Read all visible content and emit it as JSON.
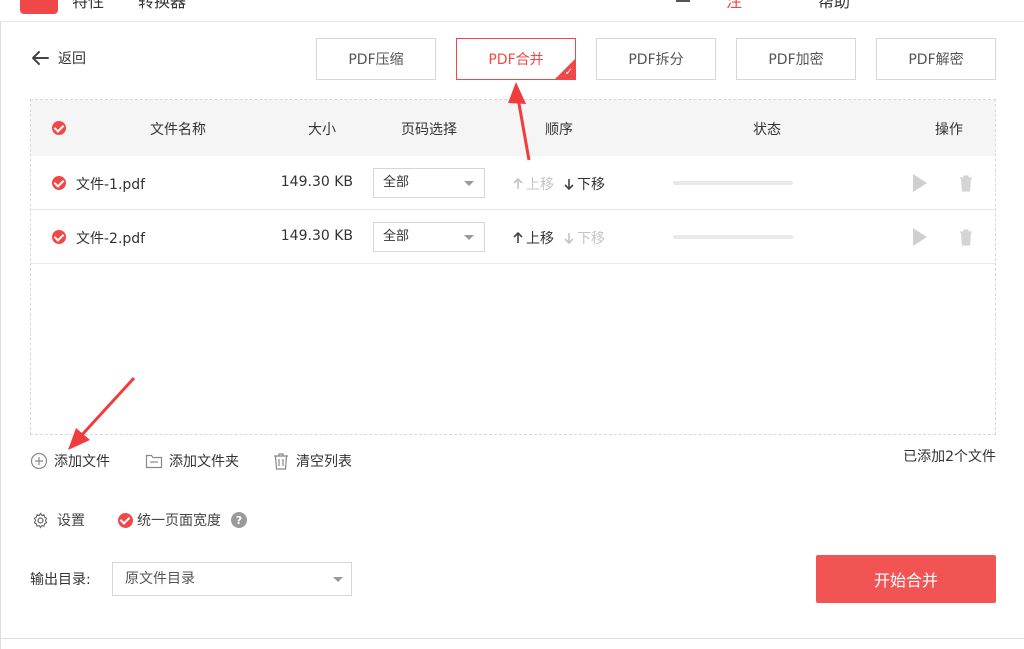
{
  "topbar": {
    "app_name_fragment": "特性",
    "app_subtitle_fragment": "转换器",
    "menu_item_2": "注",
    "menu_item_3": "帮助",
    "menu_item_4": "—"
  },
  "nav": {
    "back_label": "返回"
  },
  "tabs": [
    {
      "label": "PDF压缩",
      "active": false
    },
    {
      "label": "PDF合并",
      "active": true
    },
    {
      "label": "PDF拆分",
      "active": false
    },
    {
      "label": "PDF加密",
      "active": false
    },
    {
      "label": "PDF解密",
      "active": false
    }
  ],
  "table": {
    "headers": {
      "name": "文件名称",
      "size": "大小",
      "pages": "页码选择",
      "order": "顺序",
      "status": "状态",
      "ops": "操作"
    },
    "rows": [
      {
        "name": "文件-1.pdf",
        "size": "149.30 KB",
        "pages": "全部",
        "up": "上移",
        "down": "下移",
        "up_enabled": false,
        "down_enabled": true
      },
      {
        "name": "文件-2.pdf",
        "size": "149.30 KB",
        "pages": "全部",
        "up": "上移",
        "down": "下移",
        "up_enabled": true,
        "down_enabled": false
      }
    ]
  },
  "actions": {
    "add_file": "添加文件",
    "add_folder": "添加文件夹",
    "clear_list": "清空列表",
    "added_count": "已添加2个文件"
  },
  "settings": {
    "label": "设置",
    "unify_width": "统一页面宽度",
    "help": "?"
  },
  "output": {
    "label": "输出目录:",
    "value": "原文件目录"
  },
  "start_button": "开始合并",
  "colors": {
    "accent": "#f04848",
    "button": "#f25454"
  }
}
